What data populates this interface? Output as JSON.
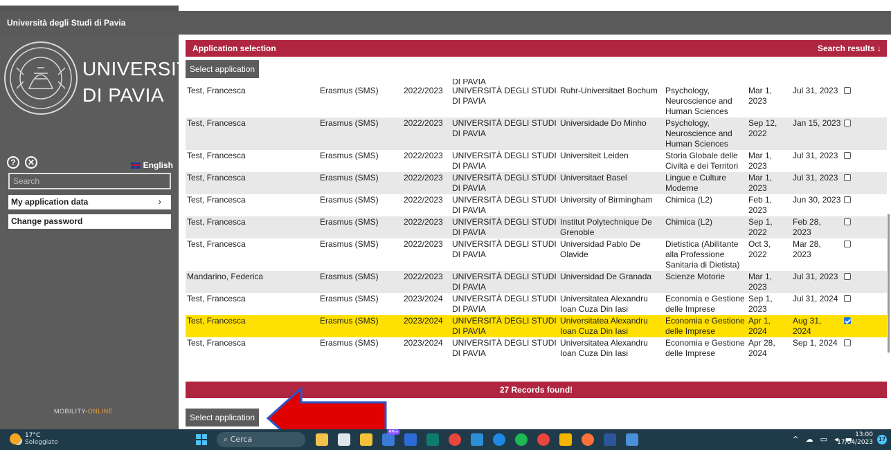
{
  "header": {
    "title": "Università degli Studi di Pavia"
  },
  "sidebar": {
    "logo_line1": "UNIVERSITÀ",
    "logo_line2": "DI PAVIA",
    "help_icon_glyph": "?",
    "close_icon_glyph": "✕",
    "language": "English",
    "search_placeholder": "Search",
    "menu": [
      {
        "label": "My application data",
        "chevron": "›"
      },
      {
        "label": "Change password"
      }
    ],
    "footer_logo_a": "MOBILITY-",
    "footer_logo_b": "ONLINE"
  },
  "main": {
    "panel_title": "Application selection",
    "search_results": "Search results ↓",
    "select_button": "Select application",
    "cut_row_text": "DI PAVIA",
    "records_found": "27 Records found!",
    "rows": [
      {
        "name": "Test, Francesca",
        "program": "Erasmus (SMS)",
        "year": "2022/2023",
        "home": "UNIVERSITÀ DEGLI STUDI DI PAVIA",
        "host": "Ruhr-Universitaet Bochum",
        "subject": "Psychology, Neuroscience and Human Sciences",
        "start": "Mar 1, 2023",
        "end": "Jul 31, 2023",
        "checked": false
      },
      {
        "name": "Test, Francesca",
        "program": "Erasmus (SMS)",
        "year": "2022/2023",
        "home": "UNIVERSITÀ DEGLI STUDI DI PAVIA",
        "host": "Universidade Do Minho",
        "subject": "Psychology, Neuroscience and Human Sciences",
        "start": "Sep 12, 2022",
        "end": "Jan 15, 2023",
        "checked": false
      },
      {
        "name": "Test, Francesca",
        "program": "Erasmus (SMS)",
        "year": "2022/2023",
        "home": "UNIVERSITÀ DEGLI STUDI DI PAVIA",
        "host": "Universiteit Leiden",
        "subject": "Storia Globale delle Civiltà e dei Territori",
        "start": "Mar 1, 2023",
        "end": "Jul 31, 2023",
        "checked": false
      },
      {
        "name": "Test, Francesca",
        "program": "Erasmus (SMS)",
        "year": "2022/2023",
        "home": "UNIVERSITÀ DEGLI STUDI DI PAVIA",
        "host": "Universitaet Basel",
        "subject": "Lingue e Culture Moderne",
        "start": "Mar 1, 2023",
        "end": "Jul 31, 2023",
        "checked": false
      },
      {
        "name": "Test, Francesca",
        "program": "Erasmus (SMS)",
        "year": "2022/2023",
        "home": "UNIVERSITÀ DEGLI STUDI DI PAVIA",
        "host": "University of Birmingham",
        "subject": "Chimica (L2)",
        "start": "Feb 1, 2023",
        "end": "Jun 30, 2023",
        "checked": false
      },
      {
        "name": "Test, Francesca",
        "program": "Erasmus (SMS)",
        "year": "2022/2023",
        "home": "UNIVERSITÀ DEGLI STUDI DI PAVIA",
        "host": "Institut Polytechnique De Grenoble",
        "subject": "Chimica (L2)",
        "start": "Sep 1, 2022",
        "end": "Feb 28, 2023",
        "checked": false
      },
      {
        "name": "Test, Francesca",
        "program": "Erasmus (SMS)",
        "year": "2022/2023",
        "home": "UNIVERSITÀ DEGLI STUDI DI PAVIA",
        "host": "Universidad Pablo De Olavide",
        "subject": "Dietistica (Abilitante alla Professione Sanitaria di Dietista)",
        "start": "Oct 3, 2022",
        "end": "Mar 28, 2023",
        "checked": false
      },
      {
        "name": "Mandarino, Federica",
        "program": "Erasmus (SMS)",
        "year": "2022/2023",
        "home": "UNIVERSITÀ DEGLI STUDI DI PAVIA",
        "host": "Universidad De Granada",
        "subject": "Scienze Motorie",
        "start": "Mar 1, 2023",
        "end": "Jul 31, 2023",
        "checked": false
      },
      {
        "name": "Test, Francesca",
        "program": "Erasmus (SMS)",
        "year": "2023/2024",
        "home": "UNIVERSITÀ DEGLI STUDI DI PAVIA",
        "host": "Universitatea Alexandru Ioan Cuza Din Iasi",
        "subject": "Economia e Gestione delle Imprese",
        "start": "Sep 1, 2023",
        "end": "Jul 31, 2024",
        "checked": false
      },
      {
        "name": "Test, Francesca",
        "program": "Erasmus (SMS)",
        "year": "2023/2024",
        "home": "UNIVERSITÀ DEGLI STUDI DI PAVIA",
        "host": "Universitatea Alexandru Ioan Cuza Din Iasi",
        "subject": "Economia e Gestione delle Imprese",
        "start": "Apr 1, 2024",
        "end": "Aug 31, 2024",
        "checked": true
      },
      {
        "name": "Test, Francesca",
        "program": "Erasmus (SMS)",
        "year": "2023/2024",
        "home": "UNIVERSITÀ DEGLI STUDI DI PAVIA",
        "host": "Universitatea Alexandru Ioan Cuza Din Iasi",
        "subject": "Economia e Gestione delle Imprese",
        "start": "Apr 28, 2024",
        "end": "Sep 1, 2024",
        "checked": false
      }
    ]
  },
  "taskbar": {
    "temperature": "17°C",
    "weather": "Soleggiato",
    "search": "Cerca",
    "mail_badge": "99+",
    "time": "13:00",
    "date": "17/04/2023",
    "notifications": "17"
  },
  "colors": {
    "accent": "#b0253f",
    "highlight": "#ffe000",
    "sidebar": "#5c5c5c"
  }
}
